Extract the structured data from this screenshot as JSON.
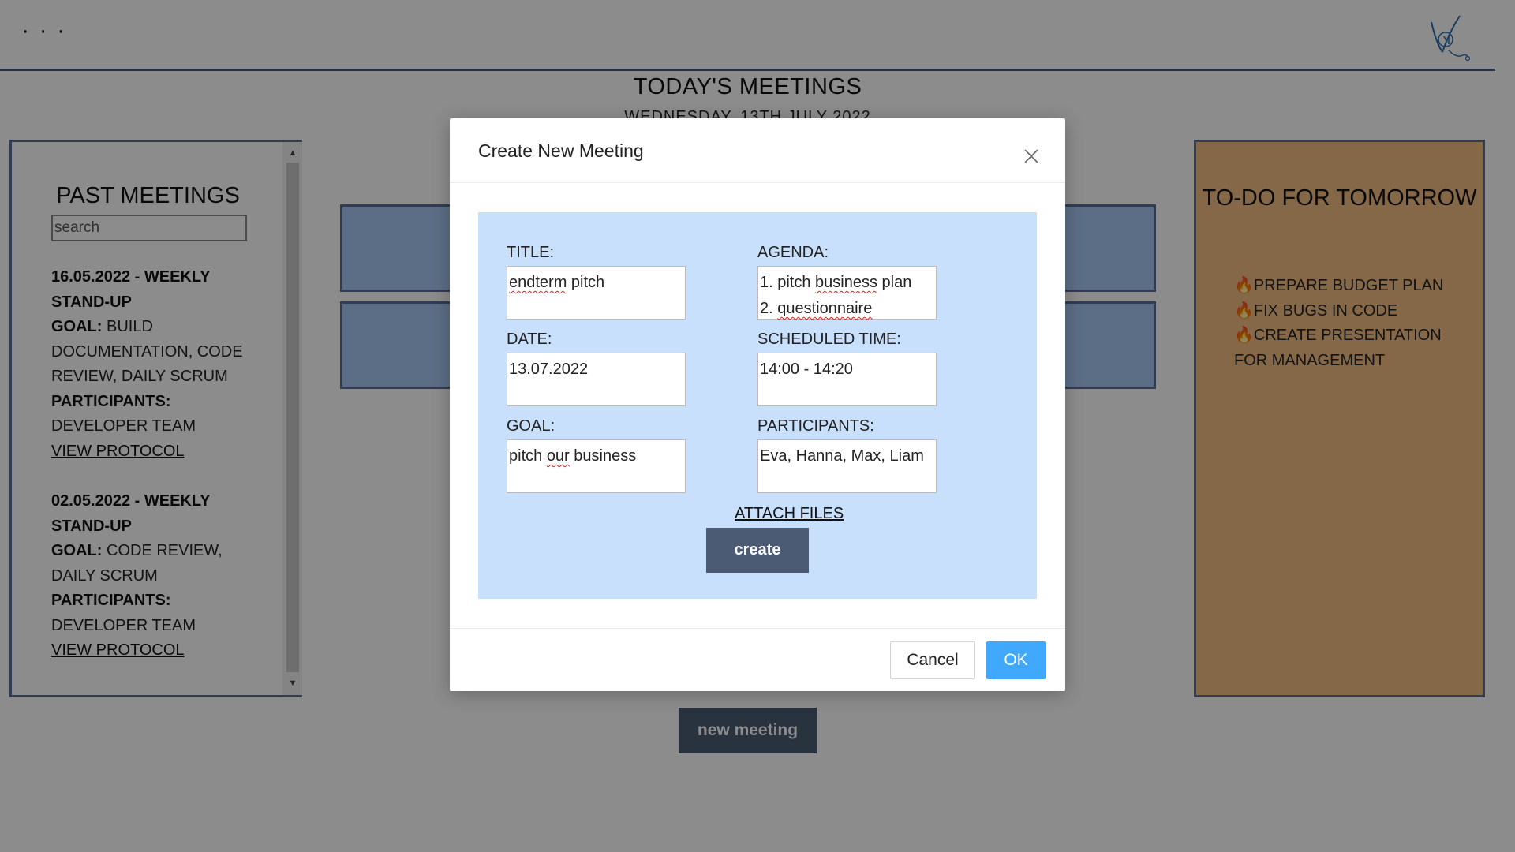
{
  "header": {
    "menu_label": "· · ·",
    "title": "TODAY'S MEETINGS",
    "date": "WEDNESDAY, 13TH JULY 2022"
  },
  "past_meetings": {
    "title": "PAST MEETINGS",
    "search_placeholder": "search",
    "items": [
      {
        "heading": "16.05.2022 - WEEKLY STAND-UP",
        "goal_label": "GOAL:",
        "goal": " BUILD DOCUMENTATION, CODE REVIEW, DAILY SCRUM",
        "participants_label": "PARTICIPANTS:",
        "participants": "DEVELOPER TEAM",
        "link": "VIEW PROTOCOL"
      },
      {
        "heading": "02.05.2022 - WEEKLY STAND-UP",
        "goal_label": "GOAL:",
        "goal": " CODE REVIEW, DAILY SCRUM",
        "participants_label": "PARTICIPANTS:",
        "participants": "DEVELOPER TEAM",
        "link": "VIEW PROTOCOL"
      }
    ]
  },
  "todo": {
    "title": "TO-DO FOR TOMORROW",
    "icon": "fire-icon",
    "items": [
      "PREPARE BUDGET PLAN",
      "FIX BUGS IN CODE",
      "CREATE PRESENTATION FOR MANAGEMENT"
    ]
  },
  "new_meeting_button": "new meeting",
  "modal": {
    "title": "Create New Meeting",
    "fields": {
      "title_label": "TITLE:",
      "title_w1": "endterm",
      "title_w2": " pitch",
      "agenda_label": "AGENDA:",
      "agenda_l1_a": "1. pitch ",
      "agenda_l1_b": "business",
      "agenda_l1_c": " plan",
      "agenda_l2_a": "2. ",
      "agenda_l2_b": "questionnaire",
      "date_label": "DATE:",
      "date_value": "13.07.2022",
      "time_label": "SCHEDULED TIME:",
      "time_value": "14:00 - 14:20",
      "goal_label": "GOAL:",
      "goal_a": "pitch ",
      "goal_b": "our",
      "goal_c": " business",
      "participants_label": "PARTICIPANTS:",
      "participants_value": "Eva, Hanna, Max, Liam"
    },
    "attach_label": "ATTACH FILES",
    "create_label": "create",
    "cancel_label": "Cancel",
    "ok_label": "OK"
  },
  "colors": {
    "accent_blue": "#40a9ff",
    "dark_button": "#4c5b74",
    "form_background": "#c8e0fc",
    "todo_background": "#f2be84",
    "meeting_card": "#a8c8f5",
    "panel_border": "#5b6e98"
  }
}
